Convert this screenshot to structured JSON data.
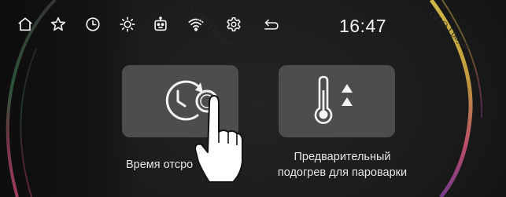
{
  "status_bar": {
    "time": "16:47",
    "icons": [
      "home-icon",
      "star-icon",
      "clock-icon",
      "sun-icon",
      "robot-icon",
      "wifi-icon",
      "gear-icon",
      "back-arrow-icon"
    ]
  },
  "tiles": [
    {
      "label": "Время отсро",
      "icon": "timer-icon"
    },
    {
      "label_line1": "Предварительный",
      "label_line2": "подогрев для пароварки",
      "icon": "thermometer-icon"
    }
  ],
  "watermark": "ООО Грауде",
  "colors": {
    "screen_bg": "#1c1c1c",
    "tile_bg": "#4d4d4d",
    "icon_color": "#f2f2f2",
    "text_color": "#e6e6e6"
  }
}
